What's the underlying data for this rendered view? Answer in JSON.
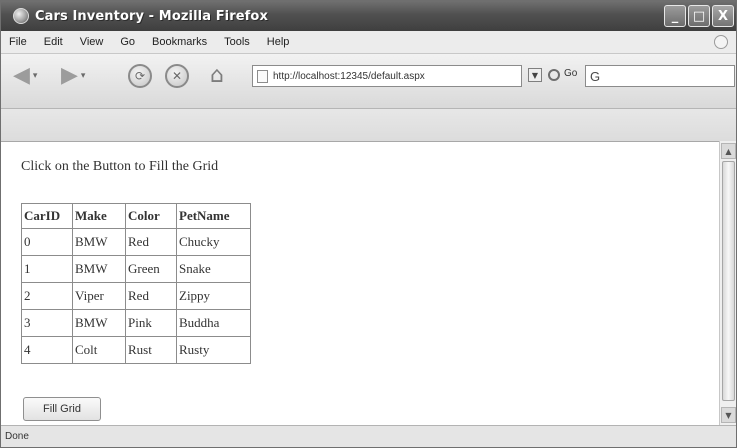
{
  "window": {
    "title": "Cars Inventory - Mozilla Firefox",
    "controls": {
      "minimize": "_",
      "maximize": "□",
      "close": "X"
    }
  },
  "menu": {
    "items": [
      {
        "label": "File"
      },
      {
        "label": "Edit"
      },
      {
        "label": "View"
      },
      {
        "label": "Go"
      },
      {
        "label": "Bookmarks"
      },
      {
        "label": "Tools"
      },
      {
        "label": "Help"
      }
    ]
  },
  "toolbar": {
    "address_url": "http://localhost:12345/default.aspx",
    "go_label": "Go",
    "search_placeholder": "G"
  },
  "page": {
    "instruction": "Click on the Button to Fill the Grid",
    "table": {
      "headers": [
        "CarID",
        "Make",
        "Color",
        "PetName"
      ],
      "rows": [
        [
          "0",
          "BMW",
          "Red",
          "Chucky"
        ],
        [
          "1",
          "BMW",
          "Green",
          "Snake"
        ],
        [
          "2",
          "Viper",
          "Red",
          "Zippy"
        ],
        [
          "3",
          "BMW",
          "Pink",
          "Buddha"
        ],
        [
          "4",
          "Colt",
          "Rust",
          "Rusty"
        ]
      ]
    },
    "fill_button_label": "Fill Grid"
  },
  "status": {
    "text": "Done"
  },
  "colors": {
    "titlebar": "#505050",
    "page_background": "#ffffff",
    "table_border": "#8c8c8c"
  }
}
